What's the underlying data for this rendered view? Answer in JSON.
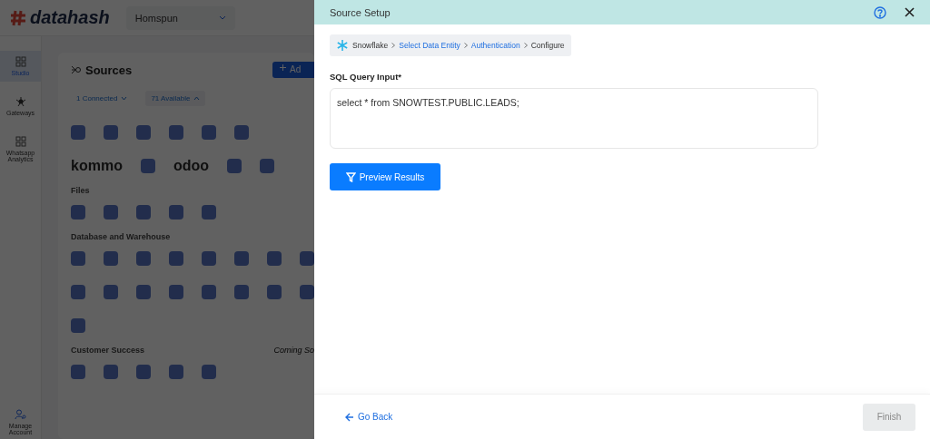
{
  "app": {
    "logo": "datahash",
    "workspace": "Homspun",
    "sidebar": [
      {
        "label": "Studio",
        "selected": true
      },
      {
        "label": "Gateways",
        "selected": false
      },
      {
        "label": "Whatsapp Analytics",
        "selected": false
      }
    ],
    "account": "Manage Account",
    "sources": {
      "title": "Sources",
      "add_button": "Ad",
      "filters": [
        {
          "label": "1 Connected",
          "selected": false
        },
        {
          "label": "71 Available",
          "selected": true
        }
      ],
      "groups": [
        {
          "rows": [
            [
              {
                "kind": "tile"
              },
              {
                "kind": "tile"
              },
              {
                "kind": "tile"
              },
              {
                "kind": "tile"
              },
              {
                "kind": "tile"
              },
              {
                "kind": "tile"
              }
            ],
            [
              {
                "kind": "wordmark",
                "label": "kommo"
              },
              {
                "kind": "tile"
              },
              {
                "kind": "wordmark",
                "label": "odoo"
              },
              {
                "kind": "tile"
              },
              {
                "kind": "tile"
              }
            ]
          ]
        },
        {
          "heading": "Files",
          "rows": [
            [
              {
                "kind": "tile"
              },
              {
                "kind": "tile"
              },
              {
                "kind": "tile"
              },
              {
                "kind": "tile"
              },
              {
                "kind": "tile"
              }
            ]
          ]
        },
        {
          "heading": "Database and Warehouse",
          "rows": [
            [
              {
                "kind": "tile"
              },
              {
                "kind": "tile"
              },
              {
                "kind": "tile"
              },
              {
                "kind": "tile"
              },
              {
                "kind": "tile"
              },
              {
                "kind": "tile"
              },
              {
                "kind": "tile"
              },
              {
                "kind": "tile"
              }
            ],
            [
              {
                "kind": "tile"
              },
              {
                "kind": "tile"
              },
              {
                "kind": "tile"
              },
              {
                "kind": "tile"
              },
              {
                "kind": "tile"
              },
              {
                "kind": "tile"
              },
              {
                "kind": "tile"
              },
              {
                "kind": "tile"
              }
            ],
            [
              {
                "kind": "tile"
              }
            ]
          ]
        },
        {
          "heading": "Customer Success",
          "note": "Coming So",
          "rows": [
            [
              {
                "kind": "tile"
              },
              {
                "kind": "tile"
              },
              {
                "kind": "tile"
              },
              {
                "kind": "tile"
              },
              {
                "kind": "tile"
              }
            ]
          ]
        }
      ]
    }
  },
  "drawer": {
    "title": "Source Setup",
    "breadcrumb": [
      {
        "label": "Snowflake",
        "kind": "source"
      },
      {
        "label": "Select Data Entity",
        "kind": "link"
      },
      {
        "label": "Authentication",
        "kind": "link"
      },
      {
        "label": "Configure",
        "kind": "current"
      }
    ],
    "field_label": "SQL Query Input*",
    "query": "select * from SNOWTEST.PUBLIC.LEADS;",
    "preview_button": "Preview Results",
    "back_link": "Go Back",
    "finish_button": {
      "label": "Finish",
      "disabled": true
    }
  }
}
